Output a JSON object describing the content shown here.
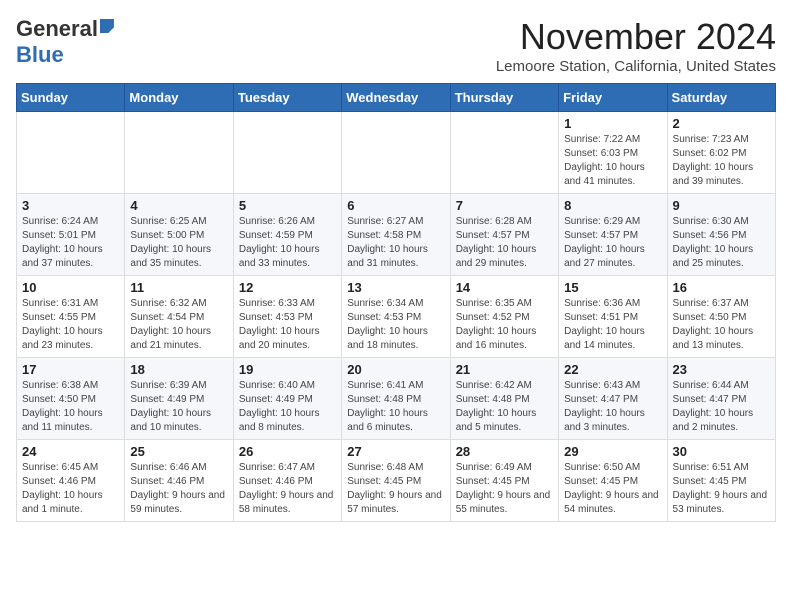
{
  "header": {
    "logo_general": "General",
    "logo_blue": "Blue",
    "month_title": "November 2024",
    "location": "Lemoore Station, California, United States"
  },
  "weekdays": [
    "Sunday",
    "Monday",
    "Tuesday",
    "Wednesday",
    "Thursday",
    "Friday",
    "Saturday"
  ],
  "weeks": [
    [
      {
        "day": "",
        "info": ""
      },
      {
        "day": "",
        "info": ""
      },
      {
        "day": "",
        "info": ""
      },
      {
        "day": "",
        "info": ""
      },
      {
        "day": "",
        "info": ""
      },
      {
        "day": "1",
        "info": "Sunrise: 7:22 AM\nSunset: 6:03 PM\nDaylight: 10 hours and 41 minutes."
      },
      {
        "day": "2",
        "info": "Sunrise: 7:23 AM\nSunset: 6:02 PM\nDaylight: 10 hours and 39 minutes."
      }
    ],
    [
      {
        "day": "3",
        "info": "Sunrise: 6:24 AM\nSunset: 5:01 PM\nDaylight: 10 hours and 37 minutes."
      },
      {
        "day": "4",
        "info": "Sunrise: 6:25 AM\nSunset: 5:00 PM\nDaylight: 10 hours and 35 minutes."
      },
      {
        "day": "5",
        "info": "Sunrise: 6:26 AM\nSunset: 4:59 PM\nDaylight: 10 hours and 33 minutes."
      },
      {
        "day": "6",
        "info": "Sunrise: 6:27 AM\nSunset: 4:58 PM\nDaylight: 10 hours and 31 minutes."
      },
      {
        "day": "7",
        "info": "Sunrise: 6:28 AM\nSunset: 4:57 PM\nDaylight: 10 hours and 29 minutes."
      },
      {
        "day": "8",
        "info": "Sunrise: 6:29 AM\nSunset: 4:57 PM\nDaylight: 10 hours and 27 minutes."
      },
      {
        "day": "9",
        "info": "Sunrise: 6:30 AM\nSunset: 4:56 PM\nDaylight: 10 hours and 25 minutes."
      }
    ],
    [
      {
        "day": "10",
        "info": "Sunrise: 6:31 AM\nSunset: 4:55 PM\nDaylight: 10 hours and 23 minutes."
      },
      {
        "day": "11",
        "info": "Sunrise: 6:32 AM\nSunset: 4:54 PM\nDaylight: 10 hours and 21 minutes."
      },
      {
        "day": "12",
        "info": "Sunrise: 6:33 AM\nSunset: 4:53 PM\nDaylight: 10 hours and 20 minutes."
      },
      {
        "day": "13",
        "info": "Sunrise: 6:34 AM\nSunset: 4:53 PM\nDaylight: 10 hours and 18 minutes."
      },
      {
        "day": "14",
        "info": "Sunrise: 6:35 AM\nSunset: 4:52 PM\nDaylight: 10 hours and 16 minutes."
      },
      {
        "day": "15",
        "info": "Sunrise: 6:36 AM\nSunset: 4:51 PM\nDaylight: 10 hours and 14 minutes."
      },
      {
        "day": "16",
        "info": "Sunrise: 6:37 AM\nSunset: 4:50 PM\nDaylight: 10 hours and 13 minutes."
      }
    ],
    [
      {
        "day": "17",
        "info": "Sunrise: 6:38 AM\nSunset: 4:50 PM\nDaylight: 10 hours and 11 minutes."
      },
      {
        "day": "18",
        "info": "Sunrise: 6:39 AM\nSunset: 4:49 PM\nDaylight: 10 hours and 10 minutes."
      },
      {
        "day": "19",
        "info": "Sunrise: 6:40 AM\nSunset: 4:49 PM\nDaylight: 10 hours and 8 minutes."
      },
      {
        "day": "20",
        "info": "Sunrise: 6:41 AM\nSunset: 4:48 PM\nDaylight: 10 hours and 6 minutes."
      },
      {
        "day": "21",
        "info": "Sunrise: 6:42 AM\nSunset: 4:48 PM\nDaylight: 10 hours and 5 minutes."
      },
      {
        "day": "22",
        "info": "Sunrise: 6:43 AM\nSunset: 4:47 PM\nDaylight: 10 hours and 3 minutes."
      },
      {
        "day": "23",
        "info": "Sunrise: 6:44 AM\nSunset: 4:47 PM\nDaylight: 10 hours and 2 minutes."
      }
    ],
    [
      {
        "day": "24",
        "info": "Sunrise: 6:45 AM\nSunset: 4:46 PM\nDaylight: 10 hours and 1 minute."
      },
      {
        "day": "25",
        "info": "Sunrise: 6:46 AM\nSunset: 4:46 PM\nDaylight: 9 hours and 59 minutes."
      },
      {
        "day": "26",
        "info": "Sunrise: 6:47 AM\nSunset: 4:46 PM\nDaylight: 9 hours and 58 minutes."
      },
      {
        "day": "27",
        "info": "Sunrise: 6:48 AM\nSunset: 4:45 PM\nDaylight: 9 hours and 57 minutes."
      },
      {
        "day": "28",
        "info": "Sunrise: 6:49 AM\nSunset: 4:45 PM\nDaylight: 9 hours and 55 minutes."
      },
      {
        "day": "29",
        "info": "Sunrise: 6:50 AM\nSunset: 4:45 PM\nDaylight: 9 hours and 54 minutes."
      },
      {
        "day": "30",
        "info": "Sunrise: 6:51 AM\nSunset: 4:45 PM\nDaylight: 9 hours and 53 minutes."
      }
    ]
  ]
}
